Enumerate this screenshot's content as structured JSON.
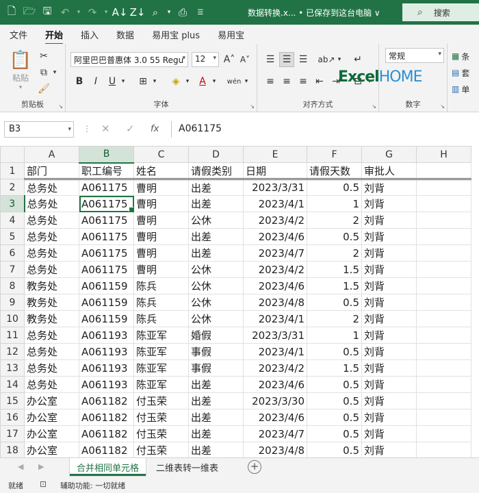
{
  "titlebar": {
    "title": "数据转换.x... • 已保存到这台电脑 ∨",
    "search_label": "搜索"
  },
  "ribbon_tabs": [
    "文件",
    "开始",
    "插入",
    "数据",
    "易用宝 plus",
    "易用宝"
  ],
  "ribbon": {
    "paste_label": "粘贴",
    "font_name": "阿里巴巴普惠体 3.0 55 Regu",
    "font_size": "12",
    "number_format": "常规",
    "wubi_label": "wén",
    "group_clipboard": "剪贴板",
    "group_font": "字体",
    "group_alignment": "对齐方式",
    "group_number": "数字",
    "cond_format_label": "条",
    "table_format_label": "套",
    "cell_style_label": "单",
    "logo_excel": "Excel",
    "logo_home": "HOME"
  },
  "formula_bar": {
    "name_box": "B3",
    "fx_label": "fx",
    "content": "A061175"
  },
  "columns": [
    "A",
    "B",
    "C",
    "D",
    "E",
    "F",
    "G",
    "H"
  ],
  "header_row": [
    "部门",
    "职工编号",
    "姓名",
    "请假类别",
    "日期",
    "请假天数",
    "审批人",
    ""
  ],
  "rows": [
    [
      "总务处",
      "A061175",
      "曹明",
      "出差",
      "2023/3/31",
      "0.5",
      "刘背"
    ],
    [
      "总务处",
      "A061175",
      "曹明",
      "出差",
      "2023/4/1",
      "1",
      "刘背"
    ],
    [
      "总务处",
      "A061175",
      "曹明",
      "公休",
      "2023/4/2",
      "2",
      "刘背"
    ],
    [
      "总务处",
      "A061175",
      "曹明",
      "出差",
      "2023/4/6",
      "0.5",
      "刘背"
    ],
    [
      "总务处",
      "A061175",
      "曹明",
      "出差",
      "2023/4/7",
      "2",
      "刘背"
    ],
    [
      "总务处",
      "A061175",
      "曹明",
      "公休",
      "2023/4/2",
      "1.5",
      "刘背"
    ],
    [
      "教务处",
      "A061159",
      "陈兵",
      "公休",
      "2023/4/6",
      "1.5",
      "刘背"
    ],
    [
      "教务处",
      "A061159",
      "陈兵",
      "公休",
      "2023/4/8",
      "0.5",
      "刘背"
    ],
    [
      "教务处",
      "A061159",
      "陈兵",
      "公休",
      "2023/4/1",
      "2",
      "刘背"
    ],
    [
      "总务处",
      "A061193",
      "陈亚军",
      "婚假",
      "2023/3/31",
      "1",
      "刘背"
    ],
    [
      "总务处",
      "A061193",
      "陈亚军",
      "事假",
      "2023/4/1",
      "0.5",
      "刘背"
    ],
    [
      "总务处",
      "A061193",
      "陈亚军",
      "事假",
      "2023/4/2",
      "1.5",
      "刘背"
    ],
    [
      "总务处",
      "A061193",
      "陈亚军",
      "出差",
      "2023/4/6",
      "0.5",
      "刘背"
    ],
    [
      "办公室",
      "A061182",
      "付玉荣",
      "出差",
      "2023/3/30",
      "0.5",
      "刘背"
    ],
    [
      "办公室",
      "A061182",
      "付玉荣",
      "出差",
      "2023/4/6",
      "0.5",
      "刘背"
    ],
    [
      "办公室",
      "A061182",
      "付玉荣",
      "出差",
      "2023/4/7",
      "0.5",
      "刘背"
    ],
    [
      "办公室",
      "A061182",
      "付玉荣",
      "出差",
      "2023/4/8",
      "0.5",
      "刘背"
    ]
  ],
  "active_cell": {
    "row": 3,
    "col": "B"
  },
  "sheet_tabs": [
    "合并相同单元格",
    "二维表转一维表"
  ],
  "active_sheet": 0,
  "status": {
    "ready": "就绪",
    "accessibility": "辅助功能: 一切就绪"
  },
  "colors": {
    "accent": "#217346",
    "selection_header": "#d3e3d8"
  }
}
